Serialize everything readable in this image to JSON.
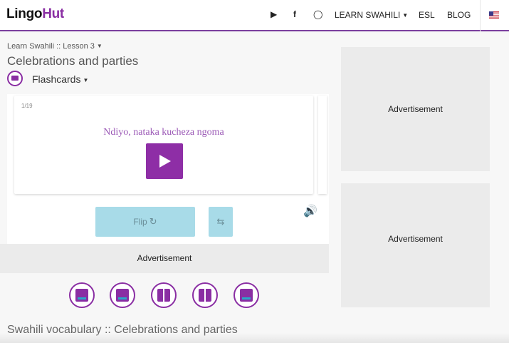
{
  "header": {
    "logo_part1": "Lingo",
    "logo_part2": "Hut",
    "nav_youtube_icon": "youtube-icon",
    "nav_facebook_icon": "facebook-icon",
    "nav_instagram_icon": "instagram-icon",
    "nav_learn": "LEARN SWAHILI",
    "nav_esl": "ESL",
    "nav_blog": "BLOG",
    "flag_icon": "us-flag-icon"
  },
  "lesson": {
    "breadcrumb": "Learn Swahili :: Lesson 3",
    "title": "Celebrations and parties",
    "mode_label": "Flashcards"
  },
  "flashcard": {
    "counter": "1/19",
    "phrase": "Ndiyo, nataka kucheza ngoma",
    "flip_label": "Flip"
  },
  "ads": {
    "band": "Advertisement",
    "right_top": "Advertisement",
    "right_bottom": "Advertisement"
  },
  "modes": [
    {
      "icon": "a-z-video-icon"
    },
    {
      "icon": "quiz-icon"
    },
    {
      "icon": "memory-grid-icon"
    },
    {
      "icon": "checklist-icon"
    },
    {
      "icon": "typing-icon"
    }
  ],
  "vocab_title": "Swahili vocabulary :: Celebrations and parties",
  "colors": {
    "brand_purple": "#8a2ea3",
    "phrase_purple": "#9b59b6",
    "button_blue": "#a8dbe8",
    "accent_cyan": "#29a8c9"
  }
}
